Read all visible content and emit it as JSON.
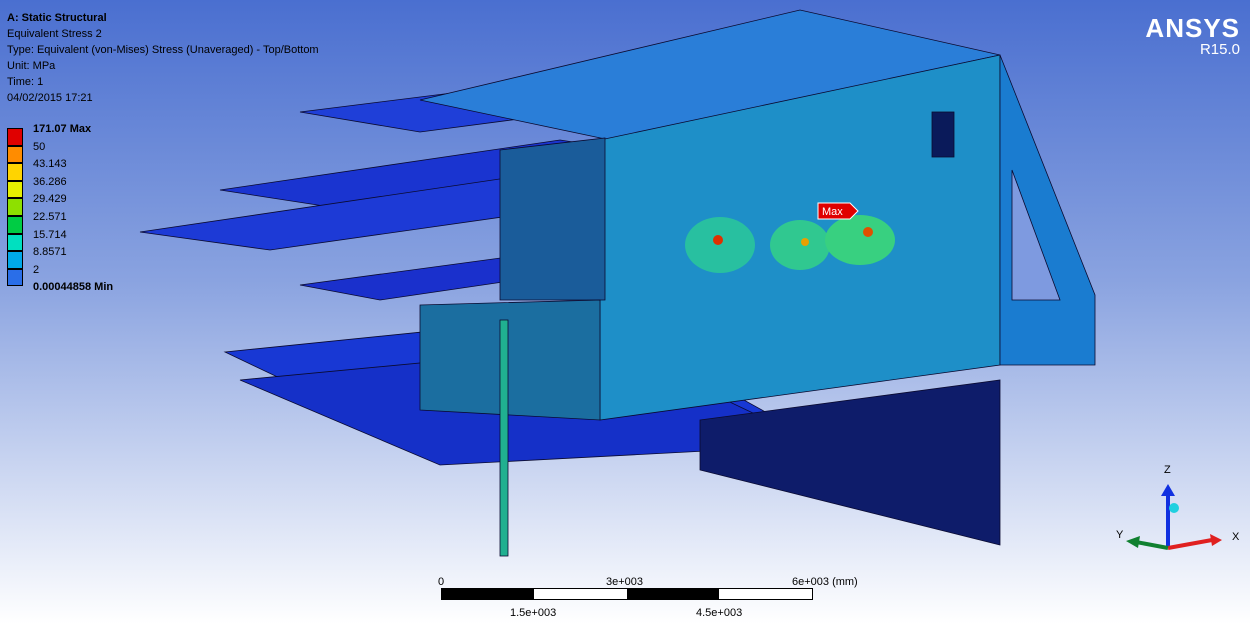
{
  "info": {
    "title": "A: Static Structural",
    "result": "Equivalent Stress 2",
    "type": "Type: Equivalent (von-Mises) Stress (Unaveraged) - Top/Bottom",
    "unit": "Unit: MPa",
    "time": "Time: 1",
    "date": "04/02/2015 17:21"
  },
  "legend": {
    "colors": [
      "#e00000",
      "#ff8c00",
      "#ffd400",
      "#e6f000",
      "#8ee000",
      "#00cc44",
      "#00e0c0",
      "#00a8e8",
      "#2a6ee8",
      "#0a14c8"
    ],
    "labels": [
      "171.07 Max",
      "50",
      "43.143",
      "36.286",
      "29.429",
      "22.571",
      "15.714",
      "8.8571",
      "2",
      "0.00044858 Min"
    ]
  },
  "brand": {
    "name": "ANSYS",
    "version": "R15.0"
  },
  "probe": {
    "label": "Max"
  },
  "scale": {
    "top_labels": [
      "0",
      "3e+003",
      "6e+003 (mm)"
    ],
    "bottom_labels": [
      "1.5e+003",
      "4.5e+003"
    ]
  },
  "triad": {
    "z": "Z",
    "y": "Y",
    "x": "X"
  }
}
